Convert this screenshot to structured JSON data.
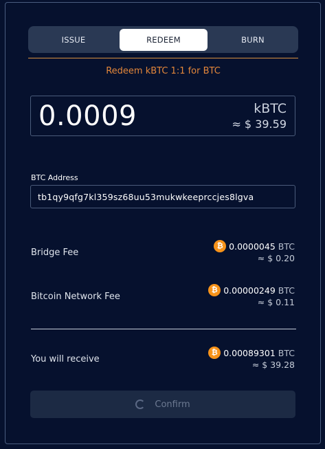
{
  "tabs": [
    {
      "label": "ISSUE"
    },
    {
      "label": "REDEEM"
    },
    {
      "label": "BURN"
    }
  ],
  "subtitle": "Redeem kBTC 1:1 for BTC",
  "amount": {
    "value": "0.0009",
    "unit": "kBTC",
    "usd": "≈ $ 39.59"
  },
  "btc_address": {
    "label": "BTC Address",
    "value": "tb1qy9qfg7kl359sz68uu53mukwkeeprccjes8lgva"
  },
  "fees": {
    "bridge": {
      "label": "Bridge Fee",
      "amount": "0.0000045",
      "unit": "BTC",
      "usd": "≈ $ 0.20"
    },
    "network": {
      "label": "Bitcoin Network Fee",
      "amount": "0.00000249",
      "unit": "BTC",
      "usd": "≈ $ 0.11"
    }
  },
  "receive": {
    "label": "You will receive",
    "amount": "0.00089301",
    "unit": "BTC",
    "usd": "≈ $ 39.28"
  },
  "confirm_label": "Confirm",
  "icon_glyph": "₿",
  "colors": {
    "accent": "#e4873a",
    "background": "#06112e",
    "bitcoin": "#f7931a"
  }
}
